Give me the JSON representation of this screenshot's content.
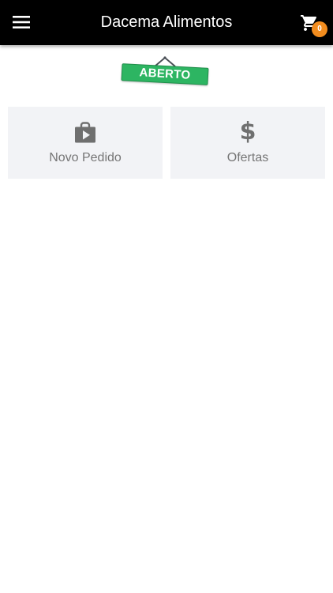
{
  "header": {
    "title": "Dacema Alimentos",
    "menu_icon": "hamburger-menu-icon",
    "cart_icon": "shopping-cart-icon",
    "cart_count": "0",
    "background_color": "#000000",
    "badge_color": "#f28c1e"
  },
  "status": {
    "label": "ABERTO",
    "color": "#2db562"
  },
  "tiles": [
    {
      "label": "Novo Pedido",
      "icon": "shopping-bag-play-icon"
    },
    {
      "label": "Ofertas",
      "icon": "dollar-sign-icon",
      "glyph": "$"
    }
  ]
}
